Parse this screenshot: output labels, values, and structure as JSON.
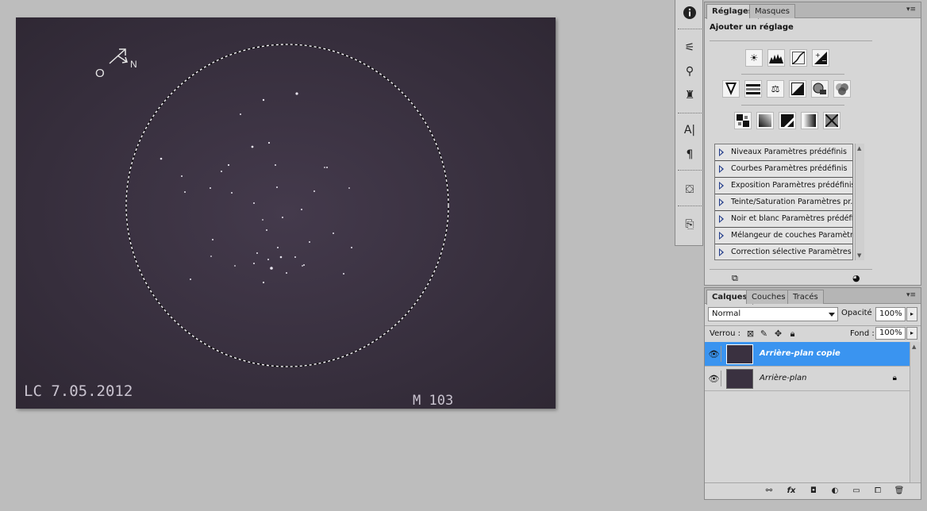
{
  "canvas": {
    "north_label": "N",
    "east_label": "O",
    "date_text": "LC 7.05.2012",
    "object_text": "M 103"
  },
  "tool_strip": {
    "icons": [
      "info-icon",
      "brush-settings-icon",
      "clone-source-icon",
      "tool-presets-icon",
      "character-icon",
      "paragraph-icon",
      "3d-icon",
      "history-icon"
    ]
  },
  "adjustments_panel": {
    "tabs": [
      {
        "label": "Réglages",
        "active": true
      },
      {
        "label": "Masques",
        "active": false
      }
    ],
    "title": "Ajouter un réglage",
    "row1_icons": [
      "brightness-contrast-icon",
      "levels-icon",
      "curves-icon",
      "exposure-icon"
    ],
    "row2_icons": [
      "vibrance-icon",
      "hue-saturation-icon",
      "color-balance-icon",
      "black-white-icon",
      "photo-filter-icon",
      "channel-mixer-icon"
    ],
    "row3_icons": [
      "invert-icon",
      "posterize-icon",
      "threshold-icon",
      "gradient-map-icon",
      "selective-color-icon"
    ],
    "presets": [
      "Niveaux Paramètres prédéfinis",
      "Courbes Paramètres prédéfinis",
      "Exposition Paramètres prédéfinis",
      "Teinte/Saturation Paramètres pr...",
      "Noir et blanc Paramètres prédéfi...",
      "Mélangeur de couches Paramètr...",
      "Correction sélective Paramètres ..."
    ]
  },
  "layers_panel": {
    "tabs": [
      {
        "label": "Calques",
        "active": true
      },
      {
        "label": "Couches",
        "active": false
      },
      {
        "label": "Tracés",
        "active": false
      }
    ],
    "blend_mode": "Normal",
    "opacity_label": "Opacité :",
    "opacity_value": "100%",
    "lock_label": "Verrou :",
    "fill_label": "Fond :",
    "fill_value": "100%",
    "layers": [
      {
        "name": "Arrière-plan copie",
        "selected": true,
        "locked": false
      },
      {
        "name": "Arrière-plan",
        "selected": false,
        "locked": true
      }
    ]
  },
  "colors": {
    "canvas_bg": "#3a3140",
    "selection_highlight": "#3a94f0",
    "workspace": "#bdbdbd"
  }
}
